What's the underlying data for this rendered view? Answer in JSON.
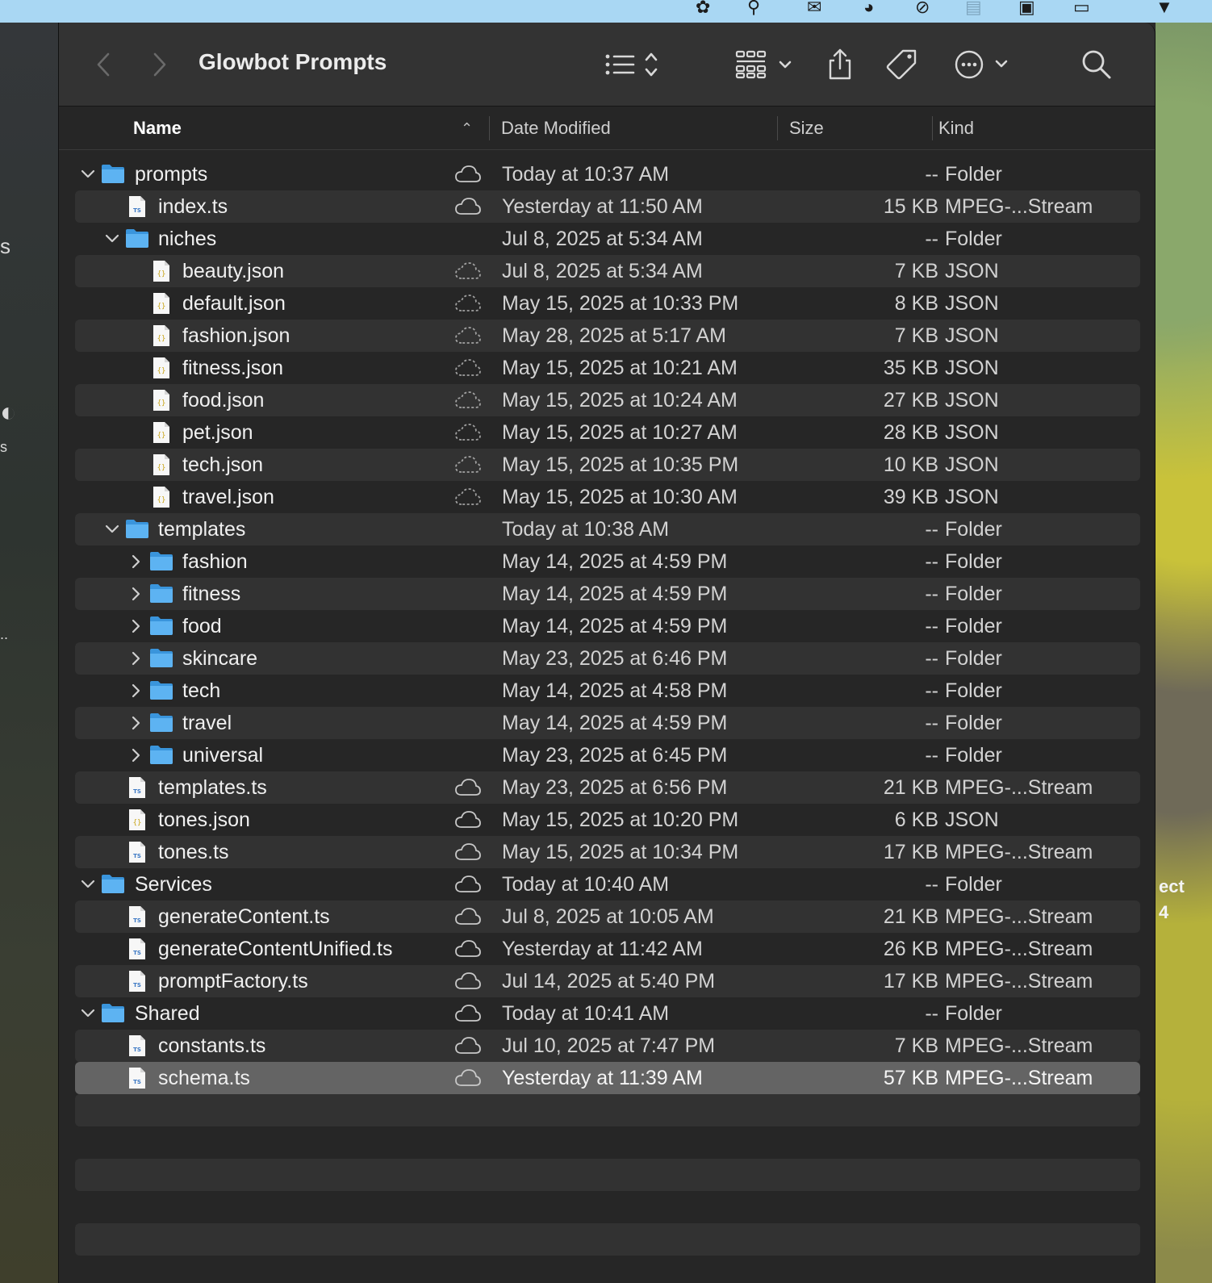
{
  "window": {
    "title": "Glowbot Prompts"
  },
  "toolbar": {
    "back": "back-chevron-icon",
    "forward": "forward-chevron-icon",
    "view_options": "list-view-icon",
    "group": "grid-group-icon",
    "share": "share-icon",
    "tags": "tag-icon",
    "more": "ellipsis-circle-icon",
    "search": "search-icon"
  },
  "columns": {
    "name": "Name",
    "date": "Date Modified",
    "size": "Size",
    "kind": "Kind"
  },
  "desktop": {
    "left_frag_1": "s",
    "left_frag_2": "s",
    "left_frag_3": "..",
    "right_frag_1": "ect",
    "right_frag_2": "4"
  },
  "colors": {
    "folder_blue": "#3f9fe6",
    "selected_row": "#646464",
    "alt_row": "#323232"
  },
  "rows": [
    {
      "name": "prompts",
      "type": "folder",
      "level": 0,
      "disclosure": "expanded",
      "cloud": "solid",
      "date": "Today at 10:37 AM",
      "size": "--",
      "kind": "Folder"
    },
    {
      "name": "index.ts",
      "type": "ts",
      "level": 1,
      "disclosure": "",
      "cloud": "solid",
      "date": "Yesterday at 11:50 AM",
      "size": "15 KB",
      "kind": "MPEG-...Stream"
    },
    {
      "name": "niches",
      "type": "folder",
      "level": 1,
      "disclosure": "expanded",
      "cloud": "",
      "date": "Jul 8, 2025 at 5:34 AM",
      "size": "--",
      "kind": "Folder"
    },
    {
      "name": "beauty.json",
      "type": "json",
      "level": 2,
      "disclosure": "",
      "cloud": "dashed",
      "date": "Jul 8, 2025 at 5:34 AM",
      "size": "7 KB",
      "kind": "JSON"
    },
    {
      "name": "default.json",
      "type": "json",
      "level": 2,
      "disclosure": "",
      "cloud": "dashed",
      "date": "May 15, 2025 at 10:33 PM",
      "size": "8 KB",
      "kind": "JSON"
    },
    {
      "name": "fashion.json",
      "type": "json",
      "level": 2,
      "disclosure": "",
      "cloud": "dashed",
      "date": "May 28, 2025 at 5:17 AM",
      "size": "7 KB",
      "kind": "JSON"
    },
    {
      "name": "fitness.json",
      "type": "json",
      "level": 2,
      "disclosure": "",
      "cloud": "dashed",
      "date": "May 15, 2025 at 10:21 AM",
      "size": "35 KB",
      "kind": "JSON"
    },
    {
      "name": "food.json",
      "type": "json",
      "level": 2,
      "disclosure": "",
      "cloud": "dashed",
      "date": "May 15, 2025 at 10:24 AM",
      "size": "27 KB",
      "kind": "JSON"
    },
    {
      "name": "pet.json",
      "type": "json",
      "level": 2,
      "disclosure": "",
      "cloud": "dashed",
      "date": "May 15, 2025 at 10:27 AM",
      "size": "28 KB",
      "kind": "JSON"
    },
    {
      "name": "tech.json",
      "type": "json",
      "level": 2,
      "disclosure": "",
      "cloud": "dashed",
      "date": "May 15, 2025 at 10:35 PM",
      "size": "10 KB",
      "kind": "JSON"
    },
    {
      "name": "travel.json",
      "type": "json",
      "level": 2,
      "disclosure": "",
      "cloud": "dashed",
      "date": "May 15, 2025 at 10:30 AM",
      "size": "39 KB",
      "kind": "JSON"
    },
    {
      "name": "templates",
      "type": "folder",
      "level": 1,
      "disclosure": "expanded",
      "cloud": "",
      "date": "Today at 10:38 AM",
      "size": "--",
      "kind": "Folder"
    },
    {
      "name": "fashion",
      "type": "folder",
      "level": 2,
      "disclosure": "collapsed",
      "cloud": "",
      "date": "May 14, 2025 at 4:59 PM",
      "size": "--",
      "kind": "Folder"
    },
    {
      "name": "fitness",
      "type": "folder",
      "level": 2,
      "disclosure": "collapsed",
      "cloud": "",
      "date": "May 14, 2025 at 4:59 PM",
      "size": "--",
      "kind": "Folder"
    },
    {
      "name": "food",
      "type": "folder",
      "level": 2,
      "disclosure": "collapsed",
      "cloud": "",
      "date": "May 14, 2025 at 4:59 PM",
      "size": "--",
      "kind": "Folder"
    },
    {
      "name": "skincare",
      "type": "folder",
      "level": 2,
      "disclosure": "collapsed",
      "cloud": "",
      "date": "May 23, 2025 at 6:46 PM",
      "size": "--",
      "kind": "Folder"
    },
    {
      "name": "tech",
      "type": "folder",
      "level": 2,
      "disclosure": "collapsed",
      "cloud": "",
      "date": "May 14, 2025 at 4:58 PM",
      "size": "--",
      "kind": "Folder"
    },
    {
      "name": "travel",
      "type": "folder",
      "level": 2,
      "disclosure": "collapsed",
      "cloud": "",
      "date": "May 14, 2025 at 4:59 PM",
      "size": "--",
      "kind": "Folder"
    },
    {
      "name": "universal",
      "type": "folder",
      "level": 2,
      "disclosure": "collapsed",
      "cloud": "",
      "date": "May 23, 2025 at 6:45 PM",
      "size": "--",
      "kind": "Folder"
    },
    {
      "name": "templates.ts",
      "type": "ts",
      "level": 1,
      "disclosure": "",
      "cloud": "solid",
      "date": "May 23, 2025 at 6:56 PM",
      "size": "21 KB",
      "kind": "MPEG-...Stream"
    },
    {
      "name": "tones.json",
      "type": "json",
      "level": 1,
      "disclosure": "",
      "cloud": "solid",
      "date": "May 15, 2025 at 10:20 PM",
      "size": "6 KB",
      "kind": "JSON"
    },
    {
      "name": "tones.ts",
      "type": "ts",
      "level": 1,
      "disclosure": "",
      "cloud": "solid",
      "date": "May 15, 2025 at 10:34 PM",
      "size": "17 KB",
      "kind": "MPEG-...Stream"
    },
    {
      "name": "Services",
      "type": "folder",
      "level": 0,
      "disclosure": "expanded",
      "cloud": "solid",
      "date": "Today at 10:40 AM",
      "size": "--",
      "kind": "Folder"
    },
    {
      "name": "generateContent.ts",
      "type": "ts",
      "level": 1,
      "disclosure": "",
      "cloud": "solid",
      "date": "Jul 8, 2025 at 10:05 AM",
      "size": "21 KB",
      "kind": "MPEG-...Stream"
    },
    {
      "name": "generateContentUnified.ts",
      "type": "ts",
      "level": 1,
      "disclosure": "",
      "cloud": "solid",
      "date": "Yesterday at 11:42 AM",
      "size": "26 KB",
      "kind": "MPEG-...Stream"
    },
    {
      "name": "promptFactory.ts",
      "type": "ts",
      "level": 1,
      "disclosure": "",
      "cloud": "solid",
      "date": "Jul 14, 2025 at 5:40 PM",
      "size": "17 KB",
      "kind": "MPEG-...Stream"
    },
    {
      "name": "Shared",
      "type": "folder",
      "level": 0,
      "disclosure": "expanded",
      "cloud": "solid",
      "date": "Today at 10:41 AM",
      "size": "--",
      "kind": "Folder"
    },
    {
      "name": "constants.ts",
      "type": "ts",
      "level": 1,
      "disclosure": "",
      "cloud": "solid",
      "date": "Jul 10, 2025 at 7:47 PM",
      "size": "7 KB",
      "kind": "MPEG-...Stream"
    },
    {
      "name": "schema.ts",
      "type": "ts",
      "level": 1,
      "disclosure": "",
      "cloud": "solid",
      "date": "Yesterday at 11:39 AM",
      "size": "57 KB",
      "kind": "MPEG-...Stream",
      "selected": true
    }
  ]
}
